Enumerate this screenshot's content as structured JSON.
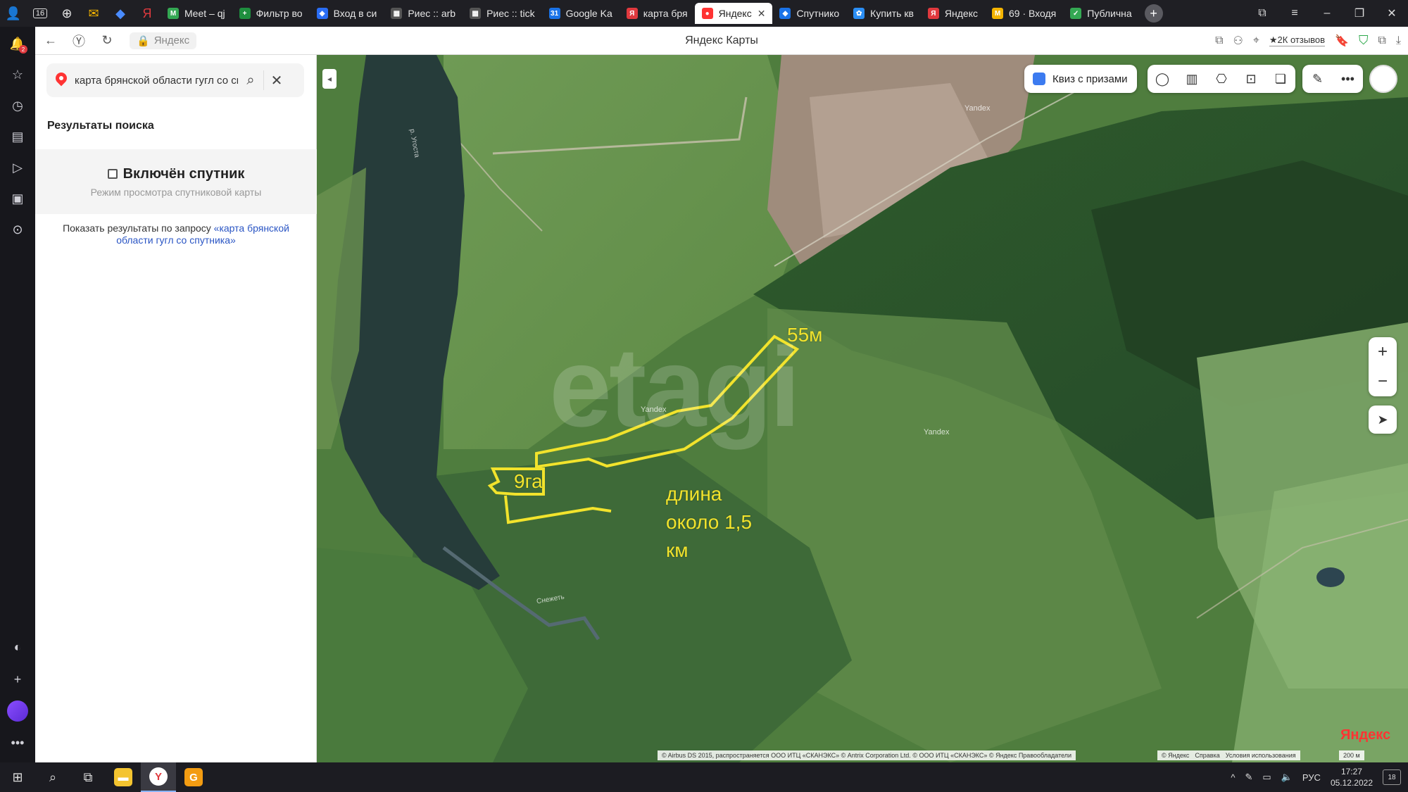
{
  "tabs": [
    {
      "label": "Meet – qj",
      "color": "#34a853",
      "glyph": "M"
    },
    {
      "label": "Фильтр во",
      "color": "#1e8e3e",
      "glyph": "+"
    },
    {
      "label": "Вход в си",
      "color": "#2a6df4",
      "glyph": "◆"
    },
    {
      "label": "Риес :: arb",
      "color": "#555555",
      "glyph": "▦"
    },
    {
      "label": "Риес :: tick",
      "color": "#555555",
      "glyph": "▦"
    },
    {
      "label": "Google Ka",
      "color": "#1a73e8",
      "glyph": "31"
    },
    {
      "label": "карта бря",
      "color": "#e0393e",
      "glyph": "Я"
    },
    {
      "label": "Яндекс",
      "color": "#ff3333",
      "glyph": "●",
      "active": true
    },
    {
      "label": "Спутнико",
      "color": "#1a73e8",
      "glyph": "◆"
    },
    {
      "label": "Купить кв",
      "color": "#2b8ef4",
      "glyph": "✿"
    },
    {
      "label": "Яндекс",
      "color": "#e0393e",
      "glyph": "Я"
    },
    {
      "label": "69 · Входя",
      "color": "#f4b400",
      "glyph": "M"
    },
    {
      "label": "Публична",
      "color": "#34a853",
      "glyph": "✓"
    }
  ],
  "browser": {
    "site_chip": "Яндекс",
    "page_title": "Яндекс Карты",
    "reviews": "★2К отзывов",
    "tab_counter": "16"
  },
  "search": {
    "query": "карта брянской области гугл со спутника",
    "results_title": "Результаты поиска",
    "satellite_title": "Включён спутник",
    "satellite_subtitle": "Режим просмотра спутниковой карты",
    "show_prefix": "Показать результаты по запросу",
    "show_link": "«карта брянской области гугл со спутника»"
  },
  "map": {
    "quiz_button": "Квиз с призами",
    "annotation_width": "55м",
    "annotation_area": "9га",
    "annotation_length_l1": "длина",
    "annotation_length_l2": "около 1,5",
    "annotation_length_l3": "км",
    "watermark": "etagi",
    "river_label_1": "р. Угоста",
    "river_label_2": "Снежеть",
    "yandex_wm_1": "Yandex",
    "yandex_wm_2": "Yandex",
    "yandex_wm_3": "Yandex",
    "logo_main": "Яндекс",
    "copyright": "© Airbus DS 2015, распространяется ООО ИТЦ «СКАНЭКС» © Antrix Corporation Ltd. © ООО ИТЦ «СКАНЭКС» © Яндекс  Правообладатели",
    "copyright_yandex": "© Яндекс",
    "help": "Справка",
    "terms": "Условия использования",
    "scale": "200 м",
    "annotation_color": "#f2e32c"
  },
  "taskbar": {
    "lang": "РУС",
    "time": "17:27",
    "date": "05.12.2022",
    "notifications": "18"
  }
}
